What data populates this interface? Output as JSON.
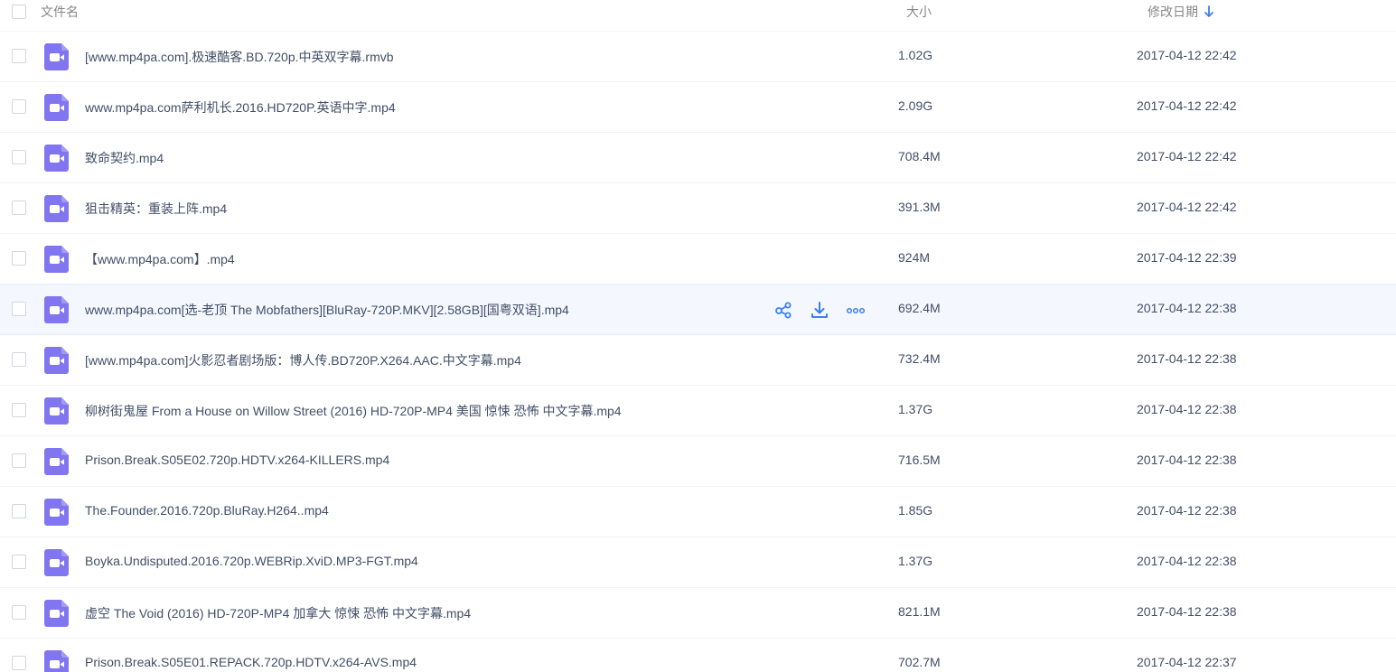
{
  "header": {
    "name_label": "文件名",
    "size_label": "大小",
    "date_label": "修改日期"
  },
  "colors": {
    "accent": "#3a7ff1",
    "video_icon": "#8275f0"
  },
  "rows": [
    {
      "name": "[www.mp4pa.com].极速酷客.BD.720p.中英双字幕.rmvb",
      "size": "1.02G",
      "date": "2017-04-12 22:42",
      "icon": "video-file-icon"
    },
    {
      "name": "www.mp4pa.com萨利机长.2016.HD720P.英语中字.mp4",
      "size": "2.09G",
      "date": "2017-04-12 22:42",
      "icon": "video-file-icon"
    },
    {
      "name": "致命契约.mp4",
      "size": "708.4M",
      "date": "2017-04-12 22:42",
      "icon": "video-file-icon"
    },
    {
      "name": "狙击精英：重装上阵.mp4",
      "size": "391.3M",
      "date": "2017-04-12 22:42",
      "icon": "video-file-icon"
    },
    {
      "name": "【www.mp4pa.com】.mp4",
      "size": "924M",
      "date": "2017-04-12 22:39",
      "icon": "video-file-icon"
    },
    {
      "name": "www.mp4pa.com[选-老顶 The Mobfathers][BluRay-720P.MKV][2.58GB][国粤双语].mp4",
      "size": "692.4M",
      "date": "2017-04-12 22:38",
      "icon": "video-file-icon",
      "hovered": true
    },
    {
      "name": "[www.mp4pa.com]火影忍者剧场版：博人传.BD720P.X264.AAC.中文字幕.mp4",
      "size": "732.4M",
      "date": "2017-04-12 22:38",
      "icon": "video-file-icon"
    },
    {
      "name": "柳树街鬼屋 From a House on Willow Street (2016) HD-720P-MP4 美国 惊悚 恐怖 中文字幕.mp4",
      "size": "1.37G",
      "date": "2017-04-12 22:38",
      "icon": "video-file-icon"
    },
    {
      "name": "Prison.Break.S05E02.720p.HDTV.x264-KILLERS.mp4",
      "size": "716.5M",
      "date": "2017-04-12 22:38",
      "icon": "video-file-icon"
    },
    {
      "name": "The.Founder.2016.720p.BluRay.H264..mp4",
      "size": "1.85G",
      "date": "2017-04-12 22:38",
      "icon": "video-file-icon"
    },
    {
      "name": "Boyka.Undisputed.2016.720p.WEBRip.XviD.MP3-FGT.mp4",
      "size": "1.37G",
      "date": "2017-04-12 22:38",
      "icon": "video-file-icon"
    },
    {
      "name": "虚空 The Void (2016) HD-720P-MP4 加拿大 惊悚 恐怖 中文字幕.mp4",
      "size": "821.1M",
      "date": "2017-04-12 22:38",
      "icon": "video-file-icon"
    },
    {
      "name": "Prison.Break.S05E01.REPACK.720p.HDTV.x264-AVS.mp4",
      "size": "702.7M",
      "date": "2017-04-12 22:37",
      "icon": "video-file-icon"
    }
  ],
  "hover_actions": [
    "share-icon",
    "download-icon",
    "more-icon"
  ]
}
